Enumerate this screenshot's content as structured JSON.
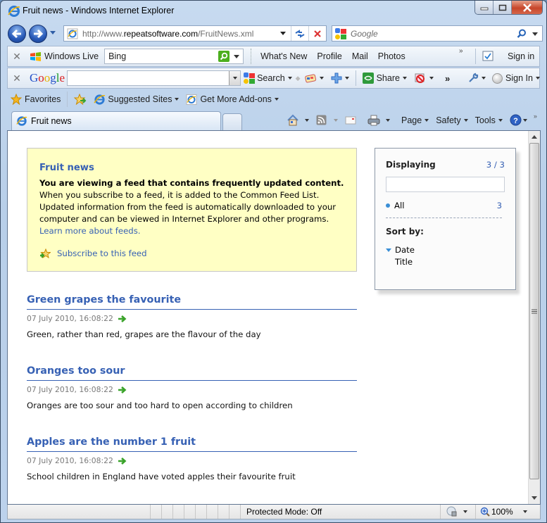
{
  "window": {
    "title": "Fruit news - Windows Internet Explorer",
    "controls": {
      "minimize": "minimize",
      "maximize": "maximize",
      "close": "close"
    }
  },
  "navigation": {
    "address_prefix": "http://www.",
    "address_domain": "repeatsoftware.com",
    "address_path": "/FruitNews.xml",
    "search_placeholder": "Google"
  },
  "windows_live_bar": {
    "brand": "Windows Live",
    "search_value": "Bing",
    "links": [
      "What's New",
      "Profile",
      "Mail",
      "Photos"
    ],
    "sign_in": "Sign in"
  },
  "google_bar": {
    "brand_letters": [
      "G",
      "o",
      "o",
      "g",
      "l",
      "e"
    ],
    "search_value": "",
    "search_label": "Search",
    "share_label": "Share",
    "overflow": "»",
    "sign_in": "Sign In"
  },
  "favorites_bar": {
    "favorites_label": "Favorites",
    "items": [
      "Suggested Sites",
      "Get More Add-ons"
    ]
  },
  "tabs": [
    {
      "label": "Fruit news",
      "active": true
    }
  ],
  "command_bar": {
    "page": "Page",
    "safety": "Safety",
    "tools": "Tools"
  },
  "feed": {
    "info": {
      "title": "Fruit news",
      "bold_line": "You are viewing a feed that contains frequently updated content.",
      "body": "When you subscribe to a feed, it is added to the Common Feed List. Updated information from the feed is automatically downloaded to your computer and can be viewed in Internet Explorer and other programs.",
      "learn_more": "Learn more about feeds.",
      "subscribe": "Subscribe to this feed"
    },
    "panel": {
      "displaying_label": "Displaying",
      "displaying_count": "3 / 3",
      "filter_value": "",
      "all_label": "All",
      "all_count": "3",
      "sort_label": "Sort by:",
      "sort_options": [
        "Date",
        "Title"
      ],
      "sort_active": "Date"
    },
    "items": [
      {
        "title": "Green grapes the favourite",
        "date": "07 July 2010, 16:08:22",
        "body": "Green, rather than red, grapes are the flavour of the day"
      },
      {
        "title": "Oranges too sour",
        "date": "07 July 2010, 16:08:22",
        "body": "Oranges are too sour and too hard to open according to children"
      },
      {
        "title": "Apples are the number 1 fruit",
        "date": "07 July 2010, 16:08:22",
        "body": "School children in England have voted apples their favourite fruit"
      }
    ]
  },
  "statusbar": {
    "protected_mode": "Protected Mode: Off",
    "zoom": "100%"
  },
  "colors": {
    "link_blue": "#3761b4",
    "info_bg": "#ffffc4",
    "arrow_green": "#3aa32a"
  }
}
